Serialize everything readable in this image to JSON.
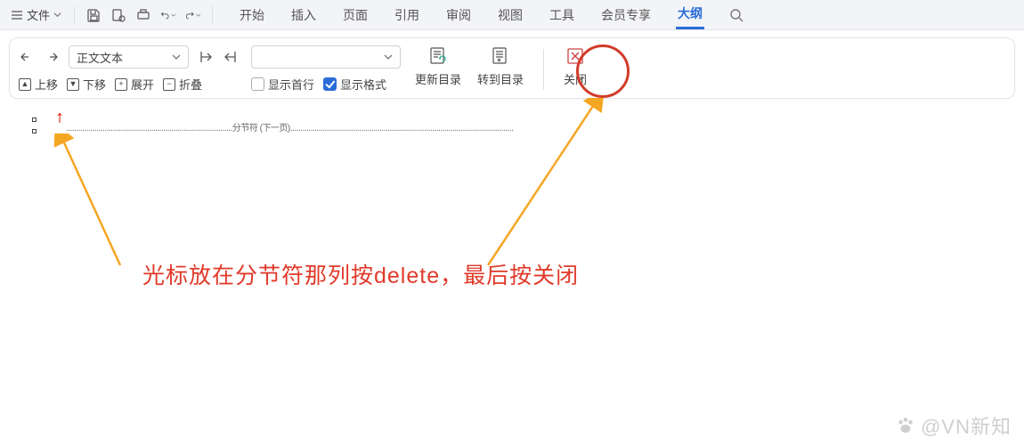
{
  "file_menu": {
    "label": "文件"
  },
  "tabs": {
    "start": "开始",
    "insert": "插入",
    "page": "页面",
    "reference": "引用",
    "review": "审阅",
    "view": "视图",
    "tools": "工具",
    "member": "会员专享",
    "outline": "大纲"
  },
  "outline_ribbon": {
    "style_select": "正文文本",
    "move_up": "上移",
    "move_down": "下移",
    "expand": "展开",
    "collapse": "折叠",
    "level_select": "",
    "show_first": "显示首行",
    "show_format": "显示格式",
    "update_toc": "更新目录",
    "goto_toc": "转到目录",
    "close": "关闭"
  },
  "document": {
    "section_break": "分节符 (下一页)"
  },
  "annotation": {
    "text": "光标放在分节符那列按delete，最后按关闭"
  },
  "watermark": "@VN新知"
}
